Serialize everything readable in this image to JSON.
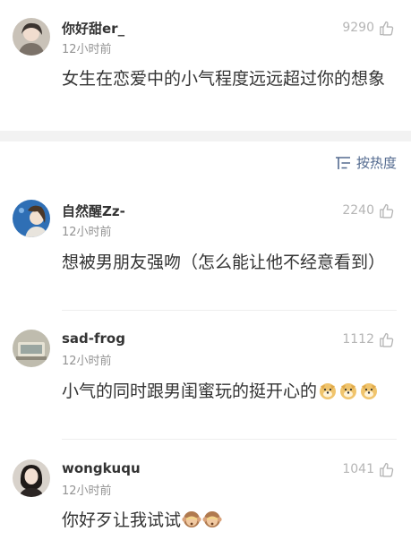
{
  "sort": {
    "label": "按热度",
    "icon": "sort-list-icon"
  },
  "comments": [
    {
      "name": "你好甜er_",
      "time": "12小时前",
      "likes": "9290",
      "text": "女生在恋爱中的小气程度远远超过你的想象",
      "avatar": "user-avatar"
    },
    {
      "name": "自然醒Zz-",
      "time": "12小时前",
      "likes": "2240",
      "text": "想被男朋友强吻（怎么能让他不经意看到）",
      "avatar": "user-avatar"
    },
    {
      "name": "sad-frog",
      "time": "12小时前",
      "likes": "1112",
      "text": "小气的同时跟男闺蜜玩的挺开心的",
      "emoji": "doge-emoji",
      "avatar": "user-avatar"
    },
    {
      "name": "wongkuqu",
      "time": "12小时前",
      "likes": "1041",
      "text": "你好歹让我试试",
      "emoji": "monkey-emoji",
      "avatar": "user-avatar"
    }
  ],
  "colors": {
    "link": "#536a8f",
    "muted": "#939393",
    "band": "#f2f2f2"
  }
}
